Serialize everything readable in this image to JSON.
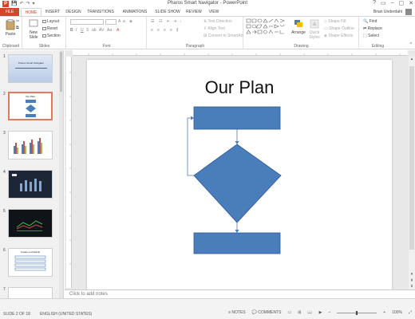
{
  "window": {
    "title": "Pharos Smart Navigator - PowerPoint",
    "controls": [
      "?",
      "▭",
      "–",
      "▢",
      "✕"
    ]
  },
  "quick_access": [
    "💾",
    "↶",
    "↷",
    "▾"
  ],
  "tabs": [
    {
      "label": "FILE"
    },
    {
      "label": "HOME"
    },
    {
      "label": "INSERT"
    },
    {
      "label": "DESIGN"
    },
    {
      "label": "TRANSITIONS"
    },
    {
      "label": "ANIMATIONS"
    },
    {
      "label": "SLIDE SHOW"
    },
    {
      "label": "REVIEW"
    },
    {
      "label": "VIEW"
    }
  ],
  "user": {
    "name": "Brian Underdahl"
  },
  "ribbon": {
    "clipboard": {
      "label": "Clipboard",
      "paste": "Paste"
    },
    "slides": {
      "label": "Slides",
      "new_slide": "New Slide",
      "layout": "Layout",
      "reset": "Reset",
      "section": "Section"
    },
    "font": {
      "label": "Font",
      "font_name": "",
      "font_size": ""
    },
    "paragraph": {
      "label": "Paragraph",
      "text_direction": "Text Direction",
      "align_text": "Align Text",
      "convert_smartart": "Convert to SmartArt"
    },
    "drawing": {
      "label": "Drawing",
      "arrange": "Arrange",
      "quick_styles": "Quick Styles",
      "shape_fill": "Shape Fill",
      "shape_outline": "Shape Outline",
      "shape_effects": "Shape Effects"
    },
    "editing": {
      "label": "Editing",
      "find": "Find",
      "replace": "Replace",
      "select": "Select"
    }
  },
  "thumbnails": [
    {
      "num": "1",
      "title": "Pharos Smart Navigator"
    },
    {
      "num": "2",
      "title": "Our Plan"
    },
    {
      "num": "3",
      "title": ""
    },
    {
      "num": "4",
      "title": ""
    },
    {
      "num": "5",
      "title": ""
    },
    {
      "num": "6",
      "title": "Create a schedule"
    },
    {
      "num": "7",
      "title": ""
    }
  ],
  "slide": {
    "title": "Our Plan",
    "shape_fill": "#4a7ebb",
    "shape_stroke": "#2f5597"
  },
  "notes": {
    "placeholder": "Click to add notes"
  },
  "status": {
    "slide_pos": "SLIDE 2 OF 18",
    "language": "ENGLISH (UNITED STATES)",
    "notes": "NOTES",
    "comments": "COMMENTS",
    "zoom": "100%"
  },
  "colors": {
    "accent": "#d24726",
    "selected_thumb": "#e07a5f"
  }
}
